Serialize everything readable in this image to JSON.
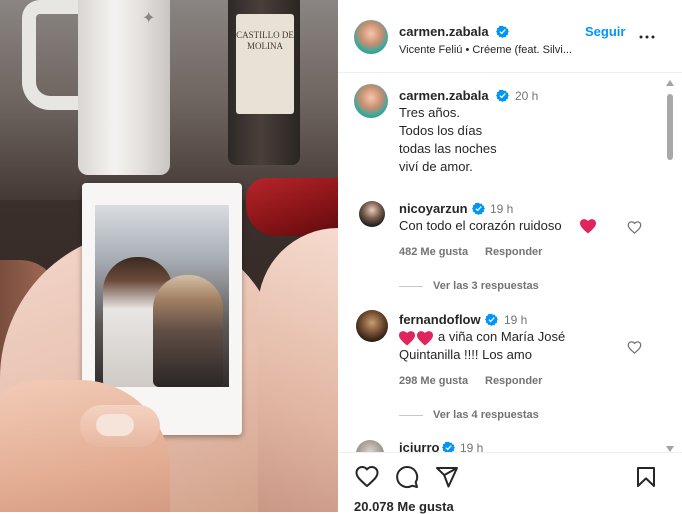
{
  "header": {
    "username": "carmen.zabala",
    "follow_label": "Seguir",
    "audio": "Vicente Feliú • Créeme (feat. Silvi..."
  },
  "photo": {
    "bottle_label": "CASTILLO DE MOLINA"
  },
  "caption": {
    "username": "carmen.zabala",
    "time": "20 h",
    "lines": [
      "Tres años.",
      "Todos los días",
      "todas las noches",
      "viví de amor."
    ]
  },
  "comments": [
    {
      "username": "nicoyarzun",
      "time": "19 h",
      "text": "Con todo el corazón ruidoso",
      "likes": "482 Me gusta",
      "reply_label": "Responder",
      "view_replies": "Ver las 3 respuestas"
    },
    {
      "username": "fernandoflow",
      "time": "19 h",
      "text_line1": "a viña con María José",
      "text_line2": "Quintanilla !!!! Los amo",
      "likes": "298 Me gusta",
      "reply_label": "Responder",
      "view_replies": "Ver las 4 respuestas"
    },
    {
      "username": "icjurro",
      "time": "19 h"
    }
  ],
  "footer": {
    "likes": "20.078 Me gusta"
  },
  "colors": {
    "accent": "#0095f6",
    "heart": "#e0245e",
    "muted": "#737373"
  },
  "icons": {
    "like": "heart-icon",
    "comment": "comment-icon",
    "share": "share-icon",
    "save": "bookmark-icon",
    "more": "more-icon",
    "verified": "verified-badge-icon"
  }
}
